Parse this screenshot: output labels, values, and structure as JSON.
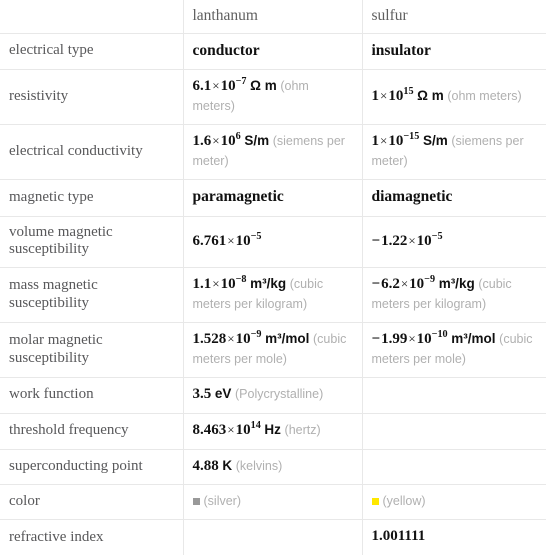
{
  "table": {
    "columns": [
      "",
      "lanthanum",
      "sulfur"
    ],
    "rows": [
      {
        "label": "electrical type",
        "lanthanum": {
          "kind": "word",
          "value": "conductor"
        },
        "sulfur": {
          "kind": "word",
          "value": "insulator"
        }
      },
      {
        "label": "resistivity",
        "lanthanum": {
          "kind": "sci",
          "mantissa": "6.1",
          "exponent": "-7",
          "unit": "Ω m",
          "note": "(ohm meters)"
        },
        "sulfur": {
          "kind": "sci",
          "mantissa": "1",
          "exponent": "15",
          "unit": "Ω m",
          "note": "(ohm meters)"
        }
      },
      {
        "label": "electrical conductivity",
        "lanthanum": {
          "kind": "sci",
          "mantissa": "1.6",
          "exponent": "6",
          "unit": "S/m",
          "note": "(siemens per meter)"
        },
        "sulfur": {
          "kind": "sci",
          "mantissa": "1",
          "exponent": "-15",
          "unit": "S/m",
          "note": "(siemens per meter)"
        }
      },
      {
        "label": "magnetic type",
        "lanthanum": {
          "kind": "word",
          "value": "paramagnetic"
        },
        "sulfur": {
          "kind": "word",
          "value": "diamagnetic"
        }
      },
      {
        "label": "volume magnetic susceptibility",
        "lanthanum": {
          "kind": "sci",
          "mantissa": "6.761",
          "exponent": "-5",
          "unit": "",
          "note": ""
        },
        "sulfur": {
          "kind": "sci",
          "sign": "−",
          "mantissa": "1.22",
          "exponent": "-5",
          "unit": "",
          "note": ""
        }
      },
      {
        "label": "mass magnetic susceptibility",
        "lanthanum": {
          "kind": "sci",
          "mantissa": "1.1",
          "exponent": "-8",
          "unit": "m³/kg",
          "note": "(cubic meters per kilogram)"
        },
        "sulfur": {
          "kind": "sci",
          "sign": "−",
          "mantissa": "6.2",
          "exponent": "-9",
          "unit": "m³/kg",
          "note": "(cubic meters per kilogram)"
        }
      },
      {
        "label": "molar magnetic susceptibility",
        "lanthanum": {
          "kind": "sci",
          "mantissa": "1.528",
          "exponent": "-9",
          "unit": "m³/mol",
          "note": "(cubic meters per mole)"
        },
        "sulfur": {
          "kind": "sci",
          "sign": "−",
          "mantissa": "1.99",
          "exponent": "-10",
          "unit": "m³/mol",
          "note": "(cubic meters per mole)"
        }
      },
      {
        "label": "work function",
        "lanthanum": {
          "kind": "plain",
          "value": "3.5",
          "unit": "eV",
          "note": "(Polycrystalline)"
        },
        "sulfur": {
          "kind": "empty"
        }
      },
      {
        "label": "threshold frequency",
        "lanthanum": {
          "kind": "sci",
          "mantissa": "8.463",
          "exponent": "14",
          "unit": "Hz",
          "note": "(hertz)"
        },
        "sulfur": {
          "kind": "empty"
        }
      },
      {
        "label": "superconducting point",
        "lanthanum": {
          "kind": "plain",
          "value": "4.88",
          "unit": "K",
          "note": "(kelvins)"
        },
        "sulfur": {
          "kind": "empty"
        }
      },
      {
        "label": "color",
        "lanthanum": {
          "kind": "color",
          "swatch": "#999999",
          "note": "(silver)"
        },
        "sulfur": {
          "kind": "color",
          "swatch": "#ffe800",
          "note": "(yellow)"
        }
      },
      {
        "label": "refractive index",
        "lanthanum": {
          "kind": "empty"
        },
        "sulfur": {
          "kind": "plain",
          "value": "1.001111",
          "unit": "",
          "note": ""
        }
      }
    ]
  }
}
